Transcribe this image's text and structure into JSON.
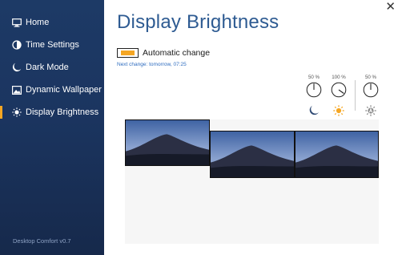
{
  "sidebar": {
    "items": [
      {
        "label": "Home",
        "icon": "monitor-icon"
      },
      {
        "label": "Time Settings",
        "icon": "half-circle-icon"
      },
      {
        "label": "Dark Mode",
        "icon": "moon-icon"
      },
      {
        "label": "Dynamic Wallpaper",
        "icon": "image-icon"
      },
      {
        "label": "Display Brightness",
        "icon": "sun-icon",
        "active": true
      }
    ],
    "version": "Desktop Comfort v0.7"
  },
  "main": {
    "title": "Display Brightness",
    "close_label": "✕",
    "auto_change": {
      "label": "Automatic change",
      "enabled": true
    },
    "next_change": "Next change: tomorrow, 07:25"
  },
  "brightness_controls": [
    {
      "label": "50 %",
      "value": 0.5,
      "icon": "moon-icon"
    },
    {
      "label": "100 %",
      "value": 1.0,
      "icon": "sun-icon"
    },
    {
      "label": "50 %",
      "value": 0.5,
      "icon": "auto-icon"
    }
  ],
  "colors": {
    "accent": "#f5a623",
    "sidebar_bg": "#1d3a66",
    "title": "#2e5b92",
    "link": "#2e6cbf"
  },
  "monitors": [
    {
      "name": "monitor-1"
    },
    {
      "name": "monitor-2"
    },
    {
      "name": "monitor-3"
    }
  ]
}
